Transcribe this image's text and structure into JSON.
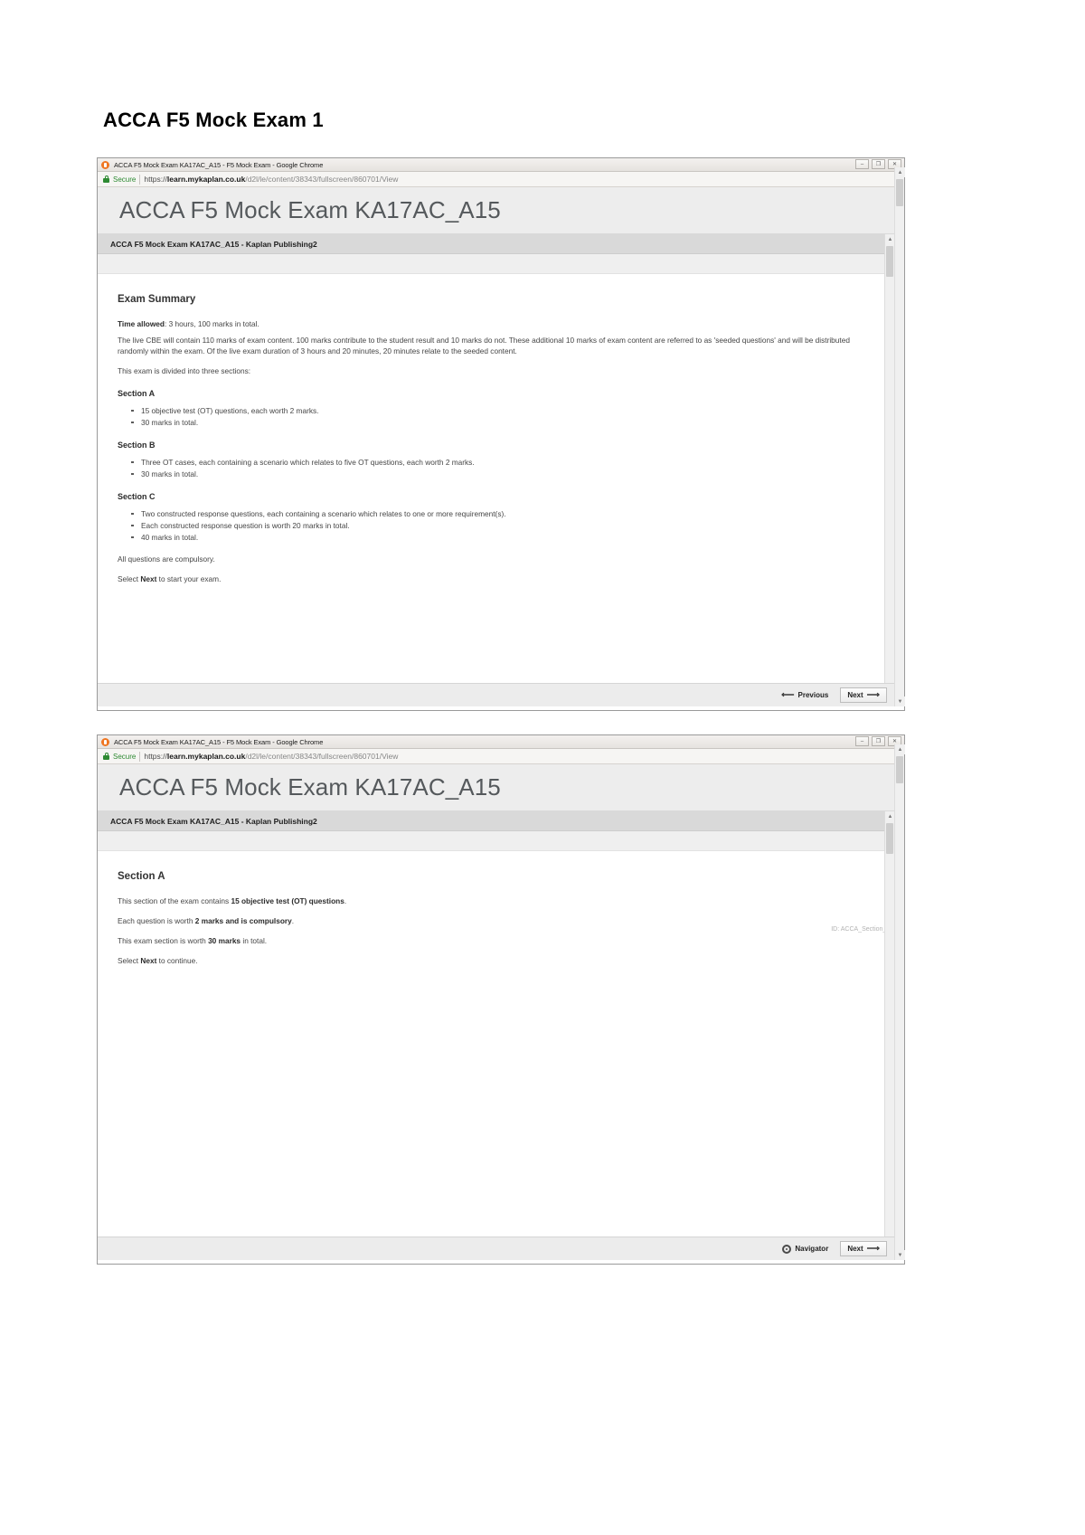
{
  "document": {
    "heading": "ACCA F5 Mock Exam 1"
  },
  "window1": {
    "titlebar": {
      "favicon": "chrome-favicon",
      "title": "ACCA F5 Mock Exam KA17AC_A15 - F5 Mock Exam - Google Chrome",
      "minimize_label": "–",
      "maximize_label": "❐",
      "close_label": "✕"
    },
    "omnibox": {
      "lock_icon": "lock-icon",
      "secure_label": "Secure",
      "url_scheme": "https://",
      "url_host": "learn.mykaplan.co.uk",
      "url_path": "/d2l/le/content/38343/fullscreen/860701/View"
    },
    "page_title": "ACCA F5 Mock Exam KA17AC_A15",
    "breadcrumb": "ACCA F5 Mock Exam KA17AC_A15 - Kaplan Publishing2",
    "content": {
      "heading": "Exam Summary",
      "time_allowed_label": "Time allowed",
      "time_allowed_value": ": 3 hours, 100 marks in total.",
      "intro_paragraph": "The live CBE will contain 110 marks of exam content. 100 marks contribute to the student result and 10 marks do not. These additional 10 marks of exam content are referred to as 'seeded questions' and will be distributed randomly within the exam. Of the live exam duration of 3 hours and 20 minutes, 20 minutes relate to the seeded content.",
      "divided_paragraph": "This exam is divided into three sections:",
      "sections": [
        {
          "heading": "Section A",
          "bullets": [
            "15 objective test (OT) questions, each worth 2 marks.",
            "30 marks in total."
          ]
        },
        {
          "heading": "Section B",
          "bullets": [
            "Three OT cases, each containing a scenario which relates to five OT questions, each worth 2 marks.",
            "30 marks in total."
          ]
        },
        {
          "heading": "Section C",
          "bullets": [
            "Two constructed response questions, each containing a scenario which relates to one or more requirement(s).",
            "Each constructed response question is worth 20 marks in total.",
            "40 marks in total."
          ]
        }
      ],
      "compulsory_paragraph": "All questions are compulsory.",
      "select_next_prefix": "Select ",
      "select_next_bold": "Next",
      "select_next_suffix": " to start your exam."
    },
    "footer": {
      "previous_label": "Previous",
      "previous_icon": "arrow-left-icon",
      "next_label": "Next",
      "next_icon": "arrow-right-icon"
    },
    "scrollbar": {
      "up_arrow": "▲",
      "down_arrow": "▼"
    }
  },
  "window2": {
    "titlebar": {
      "favicon": "chrome-favicon",
      "title": "ACCA F5 Mock Exam KA17AC_A15 - F5 Mock Exam - Google Chrome",
      "minimize_label": "–",
      "maximize_label": "❐",
      "close_label": "✕"
    },
    "omnibox": {
      "lock_icon": "lock-icon",
      "secure_label": "Secure",
      "url_scheme": "https://",
      "url_host": "learn.mykaplan.co.uk",
      "url_path": "/d2l/le/content/38343/fullscreen/860701/View"
    },
    "page_title": "ACCA F5 Mock Exam KA17AC_A15",
    "breadcrumb": "ACCA F5 Mock Exam KA17AC_A15 - Kaplan Publishing2",
    "content": {
      "heading": "Section A",
      "line1_prefix": "This section of the exam contains ",
      "line1_bold": "15 objective test (OT) questions",
      "line1_suffix": ".",
      "line2_prefix": "Each question is worth ",
      "line2_bold": "2 marks and is compulsory",
      "line2_suffix": ".",
      "line3_prefix": "This exam section is worth ",
      "line3_bold": "30 marks",
      "line3_suffix": " in total.",
      "line4_prefix": "Select ",
      "line4_bold": "Next",
      "line4_suffix": " to continue.",
      "id_tag": "ID: ACCA_Section_A"
    },
    "footer": {
      "navigator_label": "Navigator",
      "navigator_icon": "gear-icon",
      "next_label": "Next",
      "next_icon": "arrow-right-icon"
    },
    "scrollbar": {
      "up_arrow": "▲",
      "down_arrow": "▼"
    }
  }
}
